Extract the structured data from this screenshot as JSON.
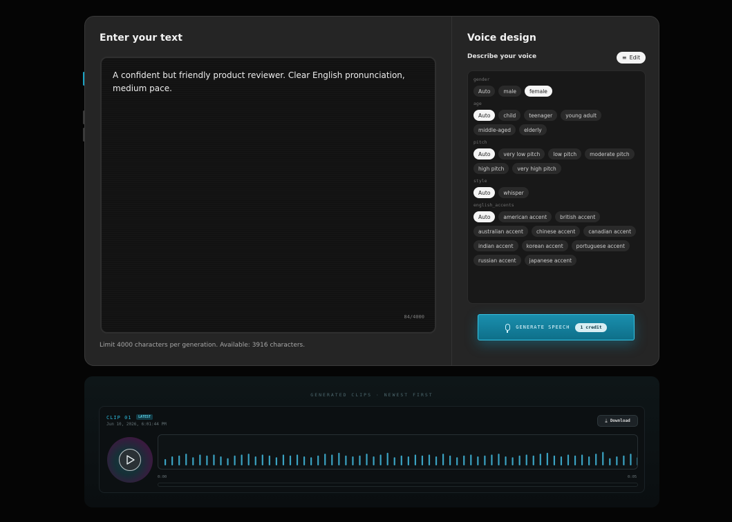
{
  "text_panel": {
    "title": "Enter your text",
    "text": "A confident but friendly product reviewer. Clear English pronunciation, medium pace.",
    "char_count": "84/4000",
    "limit_note": "Limit 4000 characters per generation. Available: 3916 characters."
  },
  "voice_panel": {
    "title": "Voice design",
    "describe_label": "Describe your voice",
    "edit_label": "Edit",
    "groups": [
      {
        "name": "gender",
        "options": [
          "Auto",
          "male",
          "female"
        ],
        "selected": "female"
      },
      {
        "name": "age",
        "options": [
          "Auto",
          "child",
          "teenager",
          "young adult",
          "middle-aged",
          "elderly"
        ],
        "selected": "Auto"
      },
      {
        "name": "pitch",
        "options": [
          "Auto",
          "very low pitch",
          "low pitch",
          "moderate pitch",
          "high pitch",
          "very high pitch"
        ],
        "selected": "Auto"
      },
      {
        "name": "style",
        "options": [
          "Auto",
          "whisper"
        ],
        "selected": "Auto"
      },
      {
        "name": "english_accents",
        "options": [
          "Auto",
          "american accent",
          "british accent",
          "australian accent",
          "chinese accent",
          "canadian accent",
          "indian accent",
          "korean accent",
          "portuguese accent",
          "russian accent",
          "japanese accent"
        ],
        "selected": "Auto"
      }
    ],
    "generate_label": "GENERATE SPEECH",
    "credit_label": "1 credit"
  },
  "clips": {
    "heading": "GENERATED CLIPS · NEWEST FIRST",
    "items": [
      {
        "label": "CLIP 01",
        "badge": "LATEST",
        "timestamp": "Jun 10, 2026, 6:01:44 PM",
        "download_label": "Download",
        "time_start": "0:00",
        "time_end": "0:05",
        "waveform": [
          0.35,
          0.5,
          0.55,
          0.65,
          0.45,
          0.6,
          0.55,
          0.6,
          0.5,
          0.4,
          0.55,
          0.6,
          0.65,
          0.5,
          0.6,
          0.55,
          0.45,
          0.6,
          0.55,
          0.6,
          0.5,
          0.45,
          0.55,
          0.65,
          0.6,
          0.7,
          0.55,
          0.5,
          0.55,
          0.65,
          0.5,
          0.6,
          0.7,
          0.45,
          0.55,
          0.5,
          0.6,
          0.55,
          0.6,
          0.5,
          0.65,
          0.55,
          0.45,
          0.55,
          0.6,
          0.5,
          0.55,
          0.6,
          0.65,
          0.5,
          0.45,
          0.55,
          0.6,
          0.55,
          0.65,
          0.7,
          0.55,
          0.5,
          0.6,
          0.55,
          0.6,
          0.5,
          0.65,
          0.75,
          0.4,
          0.5,
          0.55,
          0.65,
          0.45,
          0.6,
          0.55,
          0.6,
          0.5,
          0.45,
          0.55,
          0.65,
          0.6,
          0.55
        ]
      }
    ]
  },
  "colors": {
    "accent": "#1a8fae",
    "wave_bar": "#3fb4d6"
  }
}
